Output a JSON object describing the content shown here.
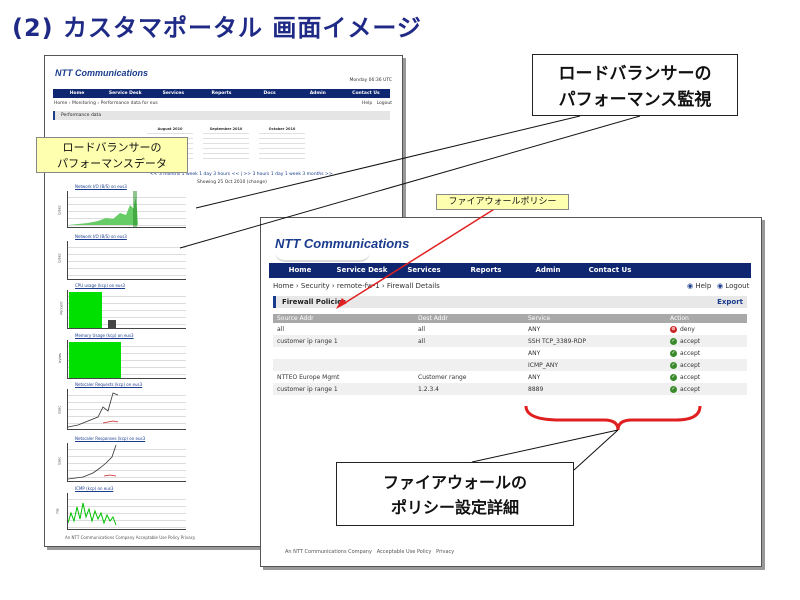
{
  "slide": {
    "title": "(2) カスタマポータル 画面イメージ"
  },
  "callouts": {
    "lb_monitor": [
      "ロードバランサーの",
      "パフォーマンス監視"
    ],
    "lb_data": [
      "ロードバランサーの",
      "パフォーマンスデータ"
    ],
    "fw_policy": "ファイアウォールポリシー",
    "fw_detail": [
      "ファイアウォールの",
      "ポリシー設定詳細"
    ]
  },
  "perf_screen": {
    "logo": "NTT Communications",
    "date": "Monday 06:36 UTC",
    "nav": [
      "Home",
      "Service Desk",
      "Services",
      "Reports",
      "Docs",
      "Admin",
      "Contact Us"
    ],
    "breadcrumb": "Home › Monitoring › Performance data for eus",
    "help": "Help",
    "logout": "Logout",
    "panel_title": "Performance data",
    "calendars": [
      "August 2010",
      "September 2010",
      "October 2010"
    ],
    "range_links": "<< 3 months 1 week 1 day 3 hours << | >> 3 hours 1 day 1 week 3 months >>",
    "showing": "Showing 25 Oct 2010 (change)",
    "graphs": [
      {
        "title": "Network I/O (B/S) on eus3",
        "ylabel": "b/sec"
      },
      {
        "title": "Network I/O (B/S) on eus3",
        "ylabel": "b/sec"
      },
      {
        "title": "CPU usage (kcp) on eus3",
        "ylabel": "Percent"
      },
      {
        "title": "Memory Usage (kcp) on eus3",
        "ylabel": "bytes"
      },
      {
        "title": "Netscaler Requests (kcp) on eus3",
        "ylabel": "r/sec"
      },
      {
        "title": "Netscaler Responses (kcp) on eus3",
        "ylabel": "r/sec"
      },
      {
        "title": "ICMP (kcp) on eus3",
        "ylabel": "ms"
      }
    ],
    "footer": "An NTT Communications Company   Acceptable Use Policy   Privacy"
  },
  "fw_screen": {
    "logo": "NTT Communications",
    "nav": [
      "Home",
      "Service Desk",
      "Services",
      "Reports",
      "Admin",
      "Contact Us"
    ],
    "breadcrumb": "Home › Security › remote-fw-1 › Firewall Details",
    "help": "Help",
    "logout": "Logout",
    "panel_title": "Firewall Policies",
    "export": "Export",
    "columns": [
      "Source Addr",
      "Dest Addr",
      "Service",
      "Action"
    ],
    "rows": [
      {
        "source": "all",
        "dest": "all",
        "service": "ANY",
        "action": "deny"
      },
      {
        "source": "customer ip range 1",
        "dest": "all",
        "service": "SSH TCP_3389-RDP",
        "action": "accept"
      },
      {
        "source": "",
        "dest": "",
        "service": "ANY",
        "action": "accept"
      },
      {
        "source": "",
        "dest": "",
        "service": "ICMP_ANY",
        "action": "accept"
      },
      {
        "source": "NTTEO Europe Mgmt",
        "dest": "Customer range",
        "service": "ANY",
        "action": "accept"
      },
      {
        "source": "customer ip range 1",
        "dest": "1.2.3.4",
        "service": "8889",
        "action": "accept"
      }
    ],
    "footer": {
      "company": "An NTT Communications Company",
      "aup": "Acceptable Use Policy",
      "privacy": "Privacy"
    }
  },
  "colors": {
    "nav": "#0f2670",
    "title": "#1f2a86",
    "callout_yellow": "#ffffb0",
    "arrow_red": "#e02020",
    "accept": "#3a8a2a",
    "deny": "#cc2222"
  }
}
